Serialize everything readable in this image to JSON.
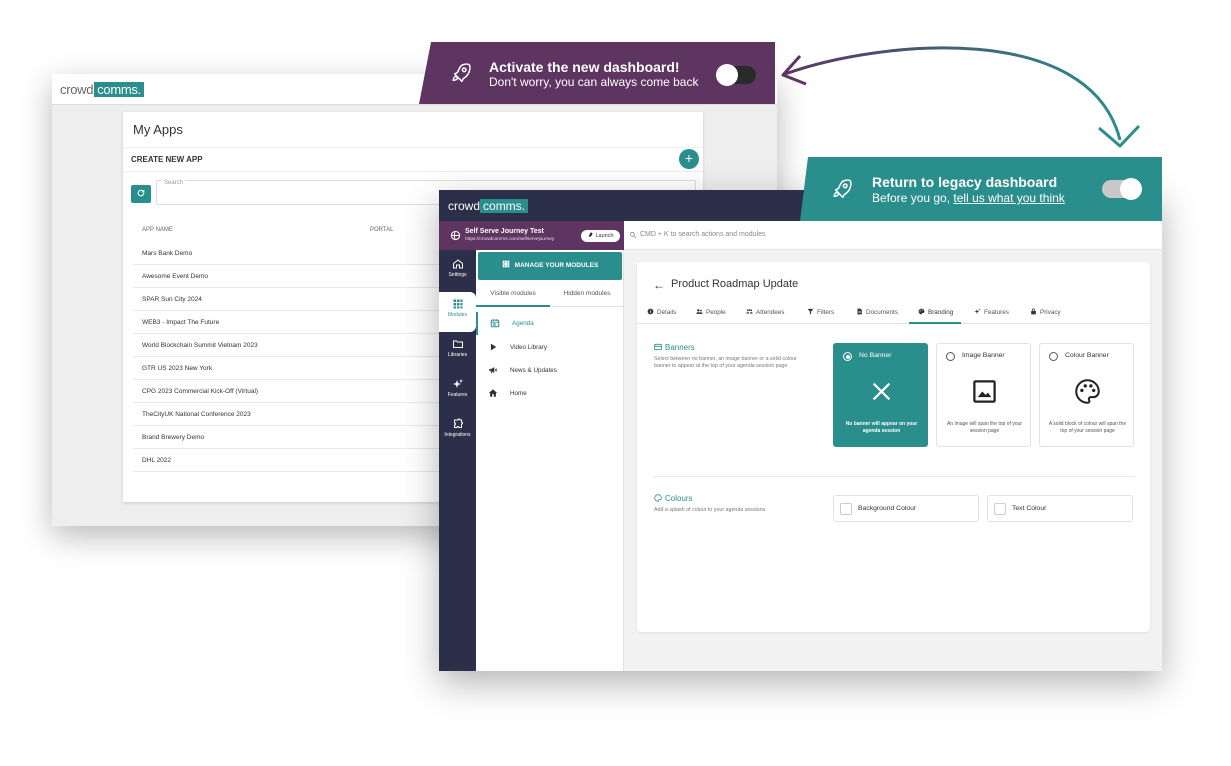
{
  "colors": {
    "purple": "#5e3560",
    "teal": "#2a8e8c",
    "navy": "#2c2f4a"
  },
  "legacy": {
    "logo": {
      "word": "crowd",
      "highlight": "comms."
    },
    "page_title": "My Apps",
    "create_label": "CREATE NEW APP",
    "plus": "+",
    "search_label": "Search",
    "columns": [
      "APP NAME",
      "PORTAL"
    ],
    "apps": [
      "Mars Bank Demo",
      "Awesome Event Demo",
      "SPAR Sun City 2024",
      "WEB3 - Impact The Future",
      "World Blockchain Summit Vietnam 2023",
      "GTR US 2023 New York",
      "CPG 2023 Commercial Kick-Off (Virtual)",
      "TheCityUK National Conference 2023",
      "Brand Brewery Demo",
      "DHL 2022"
    ]
  },
  "banner_new": {
    "title": "Activate the new dashboard!",
    "subtitle": "Don't worry, you can always come back",
    "toggle_on": false
  },
  "banner_legacy": {
    "title": "Return to legacy dashboard",
    "subtitle_prefix": "Before you go, ",
    "subtitle_link": "tell us what you think",
    "toggle_on": true
  },
  "newdash": {
    "logo": {
      "word": "crowd",
      "highlight": "comms."
    },
    "project": {
      "name": "Self Serve Journey Test",
      "url": "https://crowdcomms.com/selfservejourney",
      "launch": "Launch"
    },
    "command_placeholder": "CMD + K to search actions and modules",
    "nav": [
      {
        "label": "Settings",
        "icon": "home-icon"
      },
      {
        "label": "Modules",
        "icon": "grid-icon"
      },
      {
        "label": "Libraries",
        "icon": "folder-icon"
      },
      {
        "label": "Features",
        "icon": "sparkle-icon"
      },
      {
        "label": "Integrations",
        "icon": "puzzle-icon"
      }
    ],
    "manage_label": "MANAGE YOUR MODULES",
    "module_tabs": [
      "Visible modules",
      "Hidden modules"
    ],
    "modules": [
      {
        "label": "Agenda",
        "icon": "calendar-icon"
      },
      {
        "label": "Video Library",
        "icon": "play-icon"
      },
      {
        "label": "News & Updates",
        "icon": "megaphone-icon"
      },
      {
        "label": "Home",
        "icon": "house-icon"
      }
    ],
    "content_title": "Product Roadmap Update",
    "tabs": [
      {
        "label": "Details",
        "icon": "info-icon"
      },
      {
        "label": "People",
        "icon": "people-icon"
      },
      {
        "label": "Attendees",
        "icon": "attendees-icon"
      },
      {
        "label": "Filters",
        "icon": "filter-icon"
      },
      {
        "label": "Documents",
        "icon": "document-icon"
      },
      {
        "label": "Branding",
        "icon": "palette-icon"
      },
      {
        "label": "Features",
        "icon": "sparkle-icon"
      },
      {
        "label": "Privacy",
        "icon": "lock-icon"
      }
    ],
    "banners": {
      "title": "Banners",
      "desc": "Select between no banner, an image banner or a solid colour banner to appear at the top of your agenda session page",
      "options": [
        {
          "label": "No Banner",
          "desc": "No banner will appear on your agenda session",
          "selected": true
        },
        {
          "label": "Image Banner",
          "desc": "An image will span the top of your session page",
          "selected": false
        },
        {
          "label": "Colour Banner",
          "desc": "A solid block of colour will span the top of your session page",
          "selected": false
        }
      ]
    },
    "colours": {
      "title": "Colours",
      "desc": "Add a splash of colour to your agenda sessions",
      "fields": [
        "Background Colour",
        "Text Colour"
      ]
    }
  }
}
